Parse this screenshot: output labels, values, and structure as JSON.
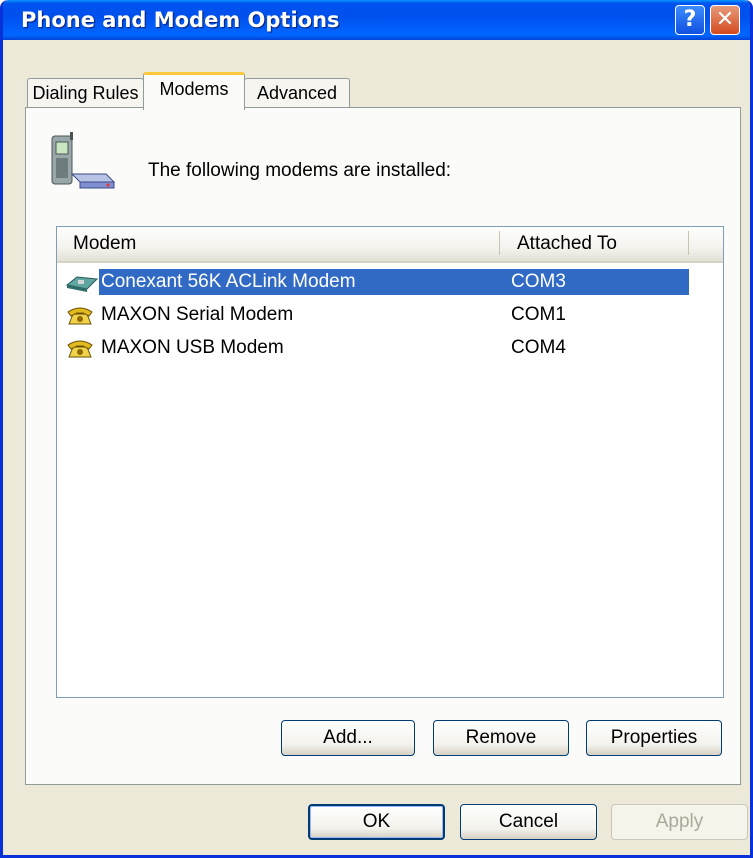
{
  "window": {
    "title": "Phone and Modem Options",
    "help_button": "?",
    "close_button": "✕"
  },
  "tabs": [
    {
      "label": "Dialing Rules",
      "active": false
    },
    {
      "label": "Modems",
      "active": true
    },
    {
      "label": "Advanced",
      "active": false
    }
  ],
  "panel": {
    "intro_text": "The following modems are  installed:",
    "intro_icon": "phone-modem-icon"
  },
  "modem_list": {
    "columns": [
      "Modem",
      "Attached To"
    ],
    "rows": [
      {
        "name": "Conexant 56K ACLink Modem",
        "port": "COM3",
        "icon": "modem-card-icon",
        "selected": true
      },
      {
        "name": "MAXON Serial Modem",
        "port": "COM1",
        "icon": "phone-icon",
        "selected": false
      },
      {
        "name": "MAXON USB Modem",
        "port": "COM4",
        "icon": "phone-icon",
        "selected": false
      }
    ]
  },
  "modem_buttons": {
    "add": "Add...",
    "remove": "Remove",
    "properties": "Properties"
  },
  "dialog_buttons": {
    "ok": "OK",
    "cancel": "Cancel",
    "apply": "Apply"
  },
  "colors": {
    "selection": "#316ac5",
    "titlebar": "#0053ee",
    "dialog_bg": "#ece9d8",
    "tab_highlight": "#ffc83c"
  }
}
